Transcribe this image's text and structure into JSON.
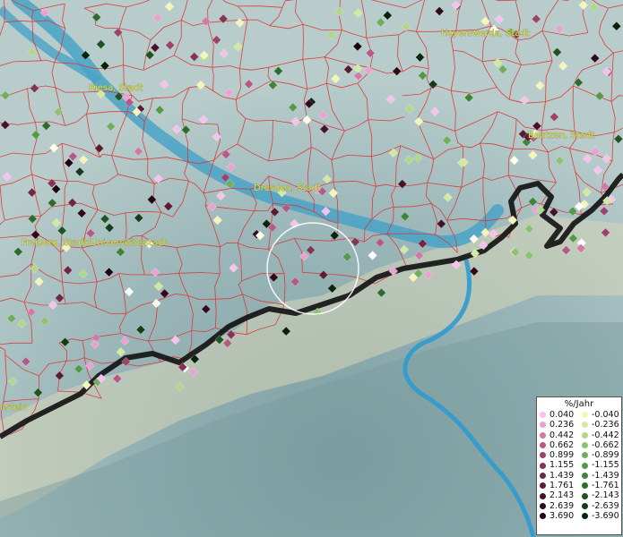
{
  "map": {
    "cities": [
      {
        "name": "Hoyerswerda, Stadt"
      },
      {
        "name": "Riesa, Stadt"
      },
      {
        "name": "Bautzen, Stadt"
      },
      {
        "name": "Dresden, Stadt"
      },
      {
        "name": "Freiberg, Stadt/Universitätsstadt"
      },
      {
        "name": "nstein"
      }
    ]
  },
  "legend": {
    "title": "%/Jahr",
    "positive": [
      {
        "label": "0.040",
        "color": "#f6c2ec"
      },
      {
        "label": "0.236",
        "color": "#e9a3d3"
      },
      {
        "label": "0.442",
        "color": "#d07aaa"
      },
      {
        "label": "0.662",
        "color": "#b45a86"
      },
      {
        "label": "0.899",
        "color": "#9a4468"
      },
      {
        "label": "1.155",
        "color": "#833553"
      },
      {
        "label": "1.439",
        "color": "#6e2843"
      },
      {
        "label": "1.761",
        "color": "#5a1c34"
      },
      {
        "label": "2.143",
        "color": "#451226"
      },
      {
        "label": "2.639",
        "color": "#300a19"
      },
      {
        "label": "3.690",
        "color": "#1a0510"
      }
    ],
    "negative": [
      {
        "label": "-0.040",
        "color": "#f4f6b8"
      },
      {
        "label": "-0.236",
        "color": "#d2e9a0"
      },
      {
        "label": "-0.442",
        "color": "#b0d88a"
      },
      {
        "label": "-0.662",
        "color": "#8cc270"
      },
      {
        "label": "-0.899",
        "color": "#6fae5a"
      },
      {
        "label": "-1.155",
        "color": "#559a48"
      },
      {
        "label": "-1.439",
        "color": "#3f843a"
      },
      {
        "label": "-1.761",
        "color": "#2e6c2e"
      },
      {
        "label": "-2.143",
        "color": "#1f5422"
      },
      {
        "label": "-2.639",
        "color": "#123d17"
      },
      {
        "label": "-3.690",
        "color": "#07230c"
      }
    ]
  }
}
